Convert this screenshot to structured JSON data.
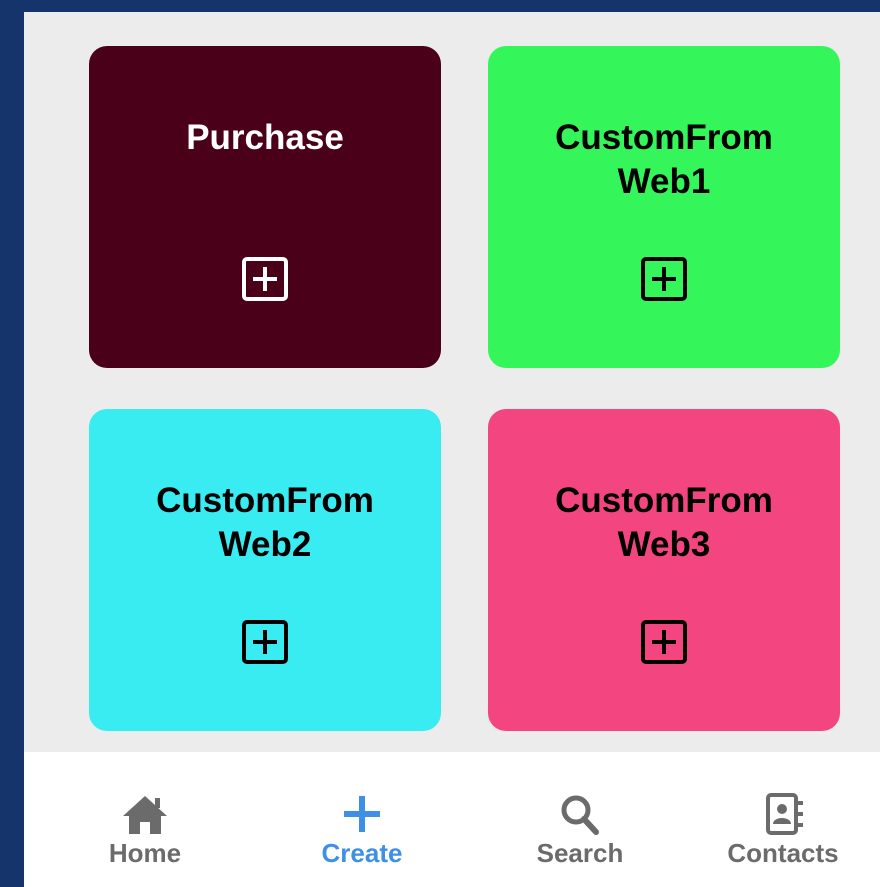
{
  "tiles": [
    {
      "label": "Purchase",
      "bg": "#4a0019",
      "fg": "#ffffff"
    },
    {
      "label": "CustomFrom\nWeb1",
      "bg": "#34f55a",
      "fg": "#000000"
    },
    {
      "label": "CustomFrom\nWeb2",
      "bg": "#38ecf2",
      "fg": "#000000"
    },
    {
      "label": "CustomFrom\nWeb3",
      "bg": "#f34580",
      "fg": "#000000"
    }
  ],
  "tile_icon": "plus-box-icon",
  "tabbar": {
    "active_index": 1,
    "active_color": "#3d90e6",
    "inactive_color": "#6b6b6b",
    "items": [
      {
        "label": "Home",
        "icon": "home-icon"
      },
      {
        "label": "Create",
        "icon": "plus-icon"
      },
      {
        "label": "Search",
        "icon": "search-icon"
      },
      {
        "label": "Contacts",
        "icon": "contacts-icon"
      }
    ]
  }
}
